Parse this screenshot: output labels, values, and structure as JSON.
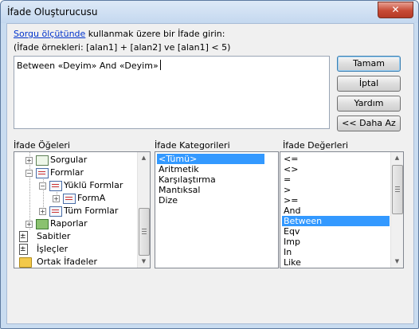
{
  "window": {
    "title": "İfade Oluşturucusu",
    "close_label": "✕"
  },
  "instructions": {
    "link_text": "Sorgu ölçütünde",
    "line1_rest": " kullanmak üzere bir İfade girin:",
    "line2": "(İfade örnekleri: [alan1] + [alan2] ve [alan1] < 5)"
  },
  "expression": {
    "value": "Between «Deyim» And «Deyim»"
  },
  "buttons": {
    "ok": "Tamam",
    "cancel": "İptal",
    "help": "Yardım",
    "less": "<< Daha Az"
  },
  "elements_panel": {
    "label": "İfade Öğeleri",
    "items": [
      {
        "label": "Sorgular",
        "icon": "query-icon",
        "expander": "+"
      },
      {
        "label": "Formlar",
        "icon": "form-icon",
        "expander": "−"
      },
      {
        "label": "Yüklü Formlar",
        "icon": "form-icon",
        "expander": "−"
      },
      {
        "label": "FormA",
        "icon": "form-icon",
        "expander": "+"
      },
      {
        "label": "Tüm Formlar",
        "icon": "form-icon",
        "expander": "+"
      },
      {
        "label": "Raporlar",
        "icon": "report-icon",
        "expander": "+"
      },
      {
        "label": "Sabitler",
        "icon": "constants-icon",
        "expander": ""
      },
      {
        "label": "İşleçler",
        "icon": "operators-icon",
        "expander": ""
      },
      {
        "label": "Ortak İfadeler",
        "icon": "common-expressions-icon",
        "expander": ""
      }
    ]
  },
  "categories_panel": {
    "label": "İfade Kategorileri",
    "items": [
      "<Tümü>",
      "Aritmetik",
      "Karşılaştırma",
      "Mantıksal",
      "Dize"
    ],
    "selected": "<Tümü>"
  },
  "values_panel": {
    "label": "İfade Değerleri",
    "items": [
      "<=",
      "<>",
      "=",
      ">",
      ">=",
      "And",
      "Between",
      "Eqv",
      "Imp",
      "In",
      "Like"
    ],
    "selected": "Between"
  },
  "colors": {
    "selection": "#3399ff",
    "link": "#0033cc",
    "close_button": "#c74a35"
  }
}
